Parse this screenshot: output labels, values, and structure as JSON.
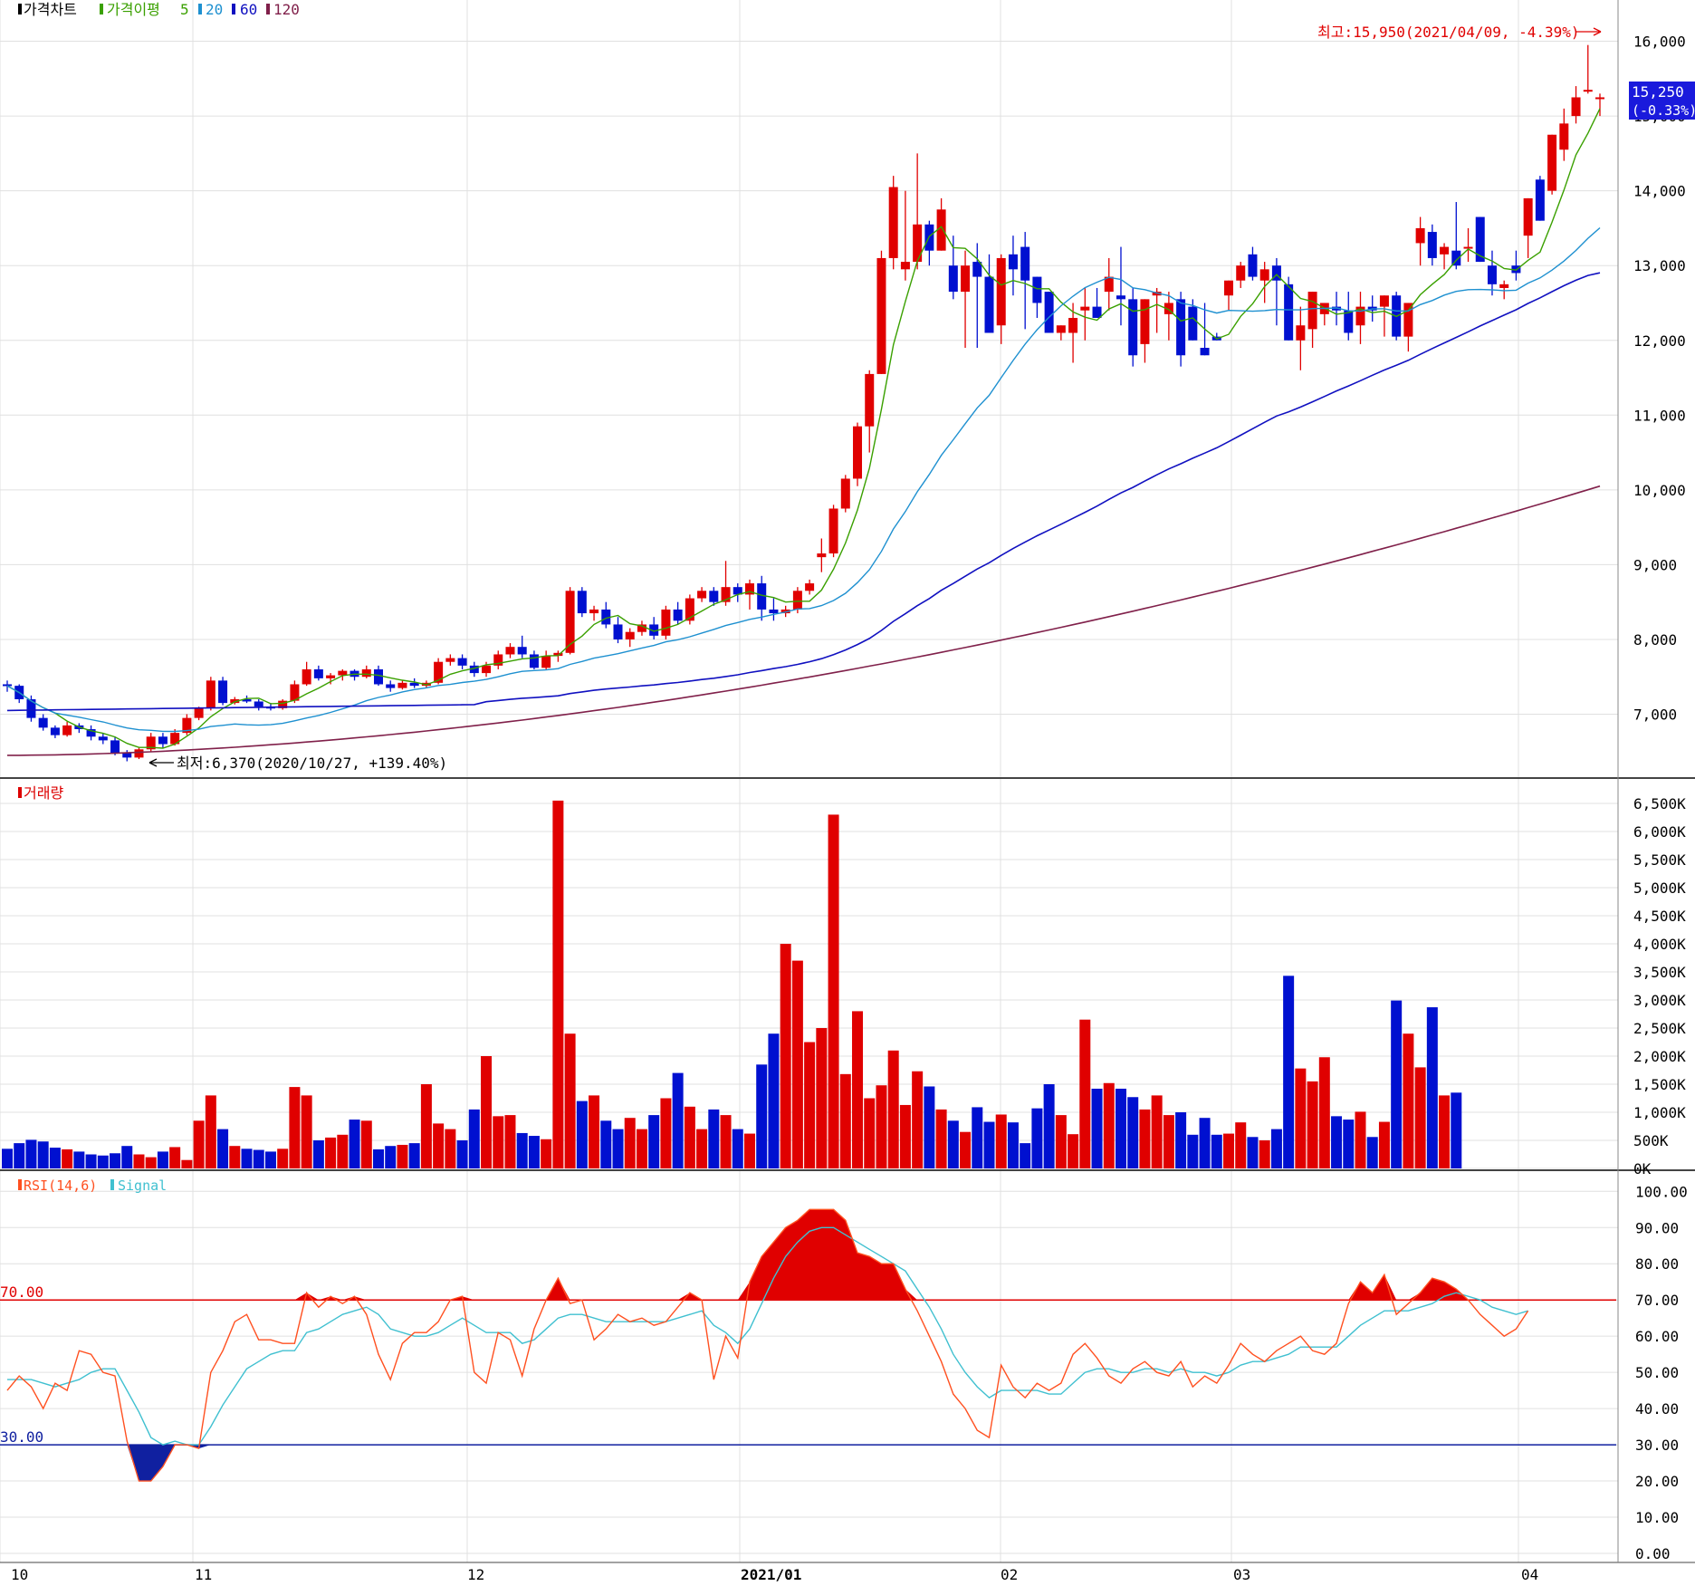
{
  "legend": {
    "price": {
      "label": "가격차트",
      "color": "#000000"
    },
    "ma_label": "가격이평",
    "ma_periods": [
      {
        "label": "5",
        "color": "#3aa000"
      },
      {
        "label": "20",
        "color": "#1e90d0"
      },
      {
        "label": "60",
        "color": "#1010c0"
      },
      {
        "label": "120",
        "color": "#80204a"
      }
    ],
    "volume": {
      "label": "거래량",
      "color": "#dd0000"
    },
    "rsi": {
      "label": "RSI(14,6)",
      "color": "#ff5020"
    },
    "signal": {
      "label": "Signal",
      "color": "#40c0d0"
    }
  },
  "annotations": {
    "high": "최고:15,950(2021/04/09, -4.39%)",
    "low": "최저:6,370(2020/10/27, +139.40%)",
    "last_price": "15,250",
    "last_change": "(-0.33%)"
  },
  "colors": {
    "up": "#e00000",
    "down": "#0010d0",
    "grid": "#e0e0e0",
    "rsi_upper": "#e00000",
    "rsi_lower": "#1020a0"
  },
  "chart_data": [
    {
      "type": "candlestick",
      "series_names": [
        "가격차트",
        "가격이평 5",
        "20",
        "60",
        "120"
      ],
      "x_ticks": [
        "10",
        "11",
        "12",
        "2021/01",
        "02",
        "03",
        "04"
      ],
      "y_ticks": [
        "7,000",
        "8,000",
        "9,000",
        "10,000",
        "11,000",
        "12,000",
        "13,000",
        "14,000",
        "15,000",
        "16,000"
      ],
      "ylim": [
        6200,
        16500
      ],
      "grid": true,
      "ohlc": [
        [
          7400,
          7450,
          7300,
          7380
        ],
        [
          7380,
          7400,
          7150,
          7200
        ],
        [
          7200,
          7250,
          6900,
          6950
        ],
        [
          6950,
          7000,
          6780,
          6820
        ],
        [
          6820,
          6850,
          6680,
          6720
        ],
        [
          6720,
          6900,
          6700,
          6850
        ],
        [
          6850,
          6880,
          6750,
          6800
        ],
        [
          6800,
          6850,
          6650,
          6700
        ],
        [
          6700,
          6750,
          6600,
          6650
        ],
        [
          6650,
          6700,
          6450,
          6480
        ],
        [
          6480,
          6520,
          6370,
          6420
        ],
        [
          6420,
          6550,
          6400,
          6530
        ],
        [
          6530,
          6750,
          6500,
          6700
        ],
        [
          6700,
          6750,
          6550,
          6600
        ],
        [
          6600,
          6800,
          6580,
          6750
        ],
        [
          6750,
          7000,
          6720,
          6950
        ],
        [
          6950,
          7100,
          6920,
          7080
        ],
        [
          7080,
          7500,
          7050,
          7450
        ],
        [
          7450,
          7500,
          7120,
          7150
        ],
        [
          7150,
          7230,
          7130,
          7200
        ],
        [
          7200,
          7250,
          7150,
          7170
        ],
        [
          7170,
          7200,
          7050,
          7100
        ],
        [
          7100,
          7150,
          7050,
          7080
        ],
        [
          7080,
          7200,
          7060,
          7180
        ],
        [
          7180,
          7450,
          7150,
          7400
        ],
        [
          7400,
          7700,
          7380,
          7600
        ],
        [
          7600,
          7650,
          7450,
          7480
        ],
        [
          7480,
          7550,
          7400,
          7520
        ],
        [
          7520,
          7600,
          7450,
          7580
        ],
        [
          7580,
          7600,
          7450,
          7500
        ],
        [
          7500,
          7650,
          7480,
          7600
        ],
        [
          7600,
          7650,
          7380,
          7400
        ],
        [
          7400,
          7450,
          7300,
          7350
        ],
        [
          7350,
          7450,
          7330,
          7420
        ],
        [
          7420,
          7480,
          7350,
          7380
        ],
        [
          7380,
          7450,
          7350,
          7420
        ],
        [
          7420,
          7750,
          7400,
          7700
        ],
        [
          7700,
          7800,
          7650,
          7750
        ],
        [
          7750,
          7800,
          7600,
          7650
        ],
        [
          7650,
          7700,
          7500,
          7550
        ],
        [
          7550,
          7700,
          7500,
          7650
        ],
        [
          7650,
          7850,
          7600,
          7800
        ],
        [
          7800,
          7950,
          7750,
          7900
        ],
        [
          7900,
          8050,
          7750,
          7800
        ],
        [
          7800,
          7850,
          7600,
          7620
        ],
        [
          7620,
          7850,
          7600,
          7780
        ],
        [
          7780,
          7850,
          7700,
          7820
        ],
        [
          7820,
          8700,
          7800,
          8650
        ],
        [
          8650,
          8700,
          8300,
          8350
        ],
        [
          8350,
          8450,
          8250,
          8400
        ],
        [
          8400,
          8500,
          8150,
          8200
        ],
        [
          8200,
          8300,
          7950,
          8000
        ],
        [
          8000,
          8150,
          7900,
          8100
        ],
        [
          8100,
          8250,
          8050,
          8200
        ],
        [
          8200,
          8300,
          8000,
          8050
        ],
        [
          8050,
          8450,
          8000,
          8400
        ],
        [
          8400,
          8500,
          8200,
          8250
        ],
        [
          8250,
          8600,
          8200,
          8550
        ],
        [
          8550,
          8700,
          8500,
          8650
        ],
        [
          8650,
          8700,
          8450,
          8500
        ],
        [
          8500,
          9050,
          8450,
          8700
        ],
        [
          8700,
          8750,
          8500,
          8600
        ],
        [
          8600,
          8800,
          8400,
          8750
        ],
        [
          8750,
          8850,
          8250,
          8400
        ],
        [
          8400,
          8550,
          8250,
          8350
        ],
        [
          8350,
          8450,
          8300,
          8400
        ],
        [
          8400,
          8700,
          8350,
          8650
        ],
        [
          8650,
          8800,
          8600,
          8750
        ],
        [
          9100,
          9350,
          8900,
          9150
        ],
        [
          9150,
          9800,
          9100,
          9750
        ],
        [
          9750,
          10200,
          9700,
          10150
        ],
        [
          10150,
          10900,
          10050,
          10850
        ],
        [
          10850,
          11600,
          10500,
          11550
        ],
        [
          11550,
          13200,
          11550,
          13100
        ],
        [
          13100,
          14200,
          12950,
          14050
        ],
        [
          12950,
          14000,
          12800,
          13050
        ],
        [
          13050,
          14500,
          12950,
          13550
        ],
        [
          13550,
          13600,
          13000,
          13200
        ],
        [
          13200,
          13900,
          13400,
          13750
        ],
        [
          13000,
          13400,
          12550,
          12650
        ],
        [
          12650,
          13200,
          11900,
          13000
        ],
        [
          13050,
          13300,
          11900,
          12850
        ],
        [
          12850,
          13150,
          12100,
          12100
        ],
        [
          12200,
          13150,
          11950,
          13100
        ],
        [
          13150,
          13400,
          12600,
          12950
        ],
        [
          13250,
          13450,
          12150,
          12800
        ],
        [
          12850,
          12700,
          12300,
          12500
        ],
        [
          12650,
          12550,
          12150,
          12100
        ],
        [
          12100,
          12200,
          12000,
          12200
        ],
        [
          12100,
          12500,
          11700,
          12300
        ],
        [
          12400,
          12700,
          12000,
          12450
        ],
        [
          12450,
          12700,
          12300,
          12300
        ],
        [
          12650,
          13100,
          12400,
          12850
        ],
        [
          12600,
          13250,
          12200,
          12550
        ],
        [
          12550,
          12700,
          11650,
          11800
        ],
        [
          11950,
          12350,
          11700,
          12550
        ],
        [
          12600,
          12700,
          12100,
          12650
        ],
        [
          12350,
          12650,
          12000,
          12500
        ],
        [
          12550,
          12650,
          11650,
          11800
        ],
        [
          12450,
          12550,
          12050,
          12000
        ],
        [
          11900,
          12500,
          12150,
          11800
        ],
        [
          12050,
          12100,
          12050,
          12000
        ],
        [
          12600,
          12700,
          12400,
          12800
        ],
        [
          12800,
          13050,
          12700,
          13000
        ],
        [
          13150,
          13250,
          12800,
          12850
        ],
        [
          12800,
          13050,
          12500,
          12950
        ],
        [
          13000,
          13100,
          12200,
          12800
        ],
        [
          12750,
          12850,
          12050,
          12000
        ],
        [
          12000,
          12450,
          11600,
          12200
        ],
        [
          12150,
          12300,
          11900,
          12650
        ],
        [
          12350,
          12450,
          12200,
          12500
        ],
        [
          12450,
          12650,
          12200,
          12400
        ],
        [
          12400,
          12650,
          12000,
          12100
        ],
        [
          12200,
          12650,
          11950,
          12450
        ],
        [
          12450,
          12600,
          12250,
          12400
        ],
        [
          12450,
          12250,
          12050,
          12600
        ],
        [
          12600,
          12650,
          12000,
          12050
        ],
        [
          12050,
          12050,
          11850,
          12500
        ],
        [
          13300,
          13650,
          13000,
          13500
        ],
        [
          13450,
          13550,
          13000,
          13100
        ],
        [
          13150,
          13300,
          12950,
          13250
        ],
        [
          13200,
          13850,
          12950,
          13000
        ],
        [
          13250,
          13500,
          13050,
          13250
        ],
        [
          13650,
          13600,
          13300,
          13050
        ],
        [
          13000,
          13200,
          12600,
          12750
        ],
        [
          12700,
          12800,
          12550,
          12750
        ],
        [
          13000,
          13200,
          12800,
          12900
        ],
        [
          13400,
          13900,
          13100,
          13900
        ],
        [
          14150,
          14200,
          14150,
          13600
        ],
        [
          14000,
          14400,
          13950,
          14750
        ],
        [
          14550,
          15100,
          14400,
          14900
        ],
        [
          15000,
          15400,
          14900,
          15250
        ],
        [
          15350,
          15950,
          15300,
          15350
        ],
        [
          15250,
          15300,
          15000,
          15250
        ]
      ],
      "ma5_endpoints": [
        7430,
        14800,
        15950
      ]
    },
    {
      "type": "bar",
      "series_names": [
        "거래량"
      ],
      "y_ticks": [
        "0K",
        "500K",
        "1,000K",
        "1,500K",
        "2,000K",
        "2,500K",
        "3,000K",
        "3,500K",
        "4,000K",
        "4,500K",
        "5,000K",
        "5,500K",
        "6,000K",
        "6,500K"
      ],
      "ylim": [
        0,
        6800000
      ],
      "values": [
        350000,
        450000,
        510000,
        480000,
        370000,
        340000,
        300000,
        250000,
        230000,
        270000,
        400000,
        250000,
        200000,
        300000,
        380000,
        150000,
        850000,
        1300000,
        700000,
        400000,
        350000,
        330000,
        300000,
        350000,
        1450000,
        1300000,
        500000,
        550000,
        600000,
        870000,
        850000,
        340000,
        400000,
        420000,
        450000,
        1500000,
        800000,
        700000,
        500000,
        1050000,
        2000000,
        930000,
        950000,
        630000,
        580000,
        520000,
        6550000,
        2400000,
        1200000,
        1300000,
        850000,
        700000,
        900000,
        700000,
        950000,
        1250000,
        1700000,
        1100000,
        700000,
        1050000,
        950000,
        700000,
        620000,
        1850000,
        2400000,
        4000000,
        3700000,
        2250000,
        2500000,
        6300000,
        1680000,
        2800000,
        1250000,
        1480000,
        2100000,
        1130000,
        1730000,
        1460000,
        1050000,
        850000,
        650000,
        1090000,
        830000,
        960000,
        820000,
        450000,
        1070000,
        1500000,
        950000,
        610000,
        2650000,
        1420000,
        1520000,
        1420000,
        1270000,
        1050000,
        1300000,
        950000,
        1000000,
        600000,
        900000,
        600000,
        620000,
        820000,
        560000,
        500000,
        700000,
        3430000,
        1780000,
        1550000,
        1980000,
        930000,
        870000,
        1010000,
        560000,
        830000,
        2990000,
        2400000,
        1800000,
        2870000,
        1300000,
        1350000
      ]
    },
    {
      "type": "line",
      "series_names": [
        "RSI(14,6)",
        "Signal"
      ],
      "y_ticks": [
        "0.00",
        "10.00",
        "20.00",
        "30.00",
        "40.00",
        "50.00",
        "60.00",
        "70.00",
        "80.00",
        "90.00",
        "100.00"
      ],
      "ylim": [
        0,
        100
      ],
      "reference_lines": [
        {
          "value": 70,
          "label": "70.00"
        },
        {
          "value": 30,
          "label": "30.00"
        }
      ],
      "rsi": [
        45,
        49,
        46,
        40,
        47,
        45,
        56,
        55,
        50,
        49,
        31,
        20,
        20,
        24,
        30,
        30,
        29,
        50,
        56,
        64,
        66,
        59,
        59,
        58,
        58,
        72,
        68,
        71,
        69,
        71,
        66,
        55,
        48,
        58,
        61,
        61,
        64,
        70,
        71,
        50,
        47,
        61,
        59,
        49,
        62,
        70,
        76,
        69,
        70,
        59,
        62,
        66,
        64,
        65,
        63,
        64,
        68,
        72,
        70,
        48,
        60,
        54,
        75,
        82,
        86,
        90,
        92,
        95,
        95,
        95,
        92,
        83,
        82,
        80,
        80,
        73,
        67,
        60,
        53,
        44,
        40,
        34,
        32,
        52,
        46,
        43,
        47,
        45,
        47,
        55,
        58,
        54,
        49,
        47,
        51,
        53,
        50,
        49,
        53,
        46,
        49,
        47,
        52,
        58,
        55,
        53,
        56,
        58,
        60,
        56,
        55,
        58,
        69,
        75,
        72,
        77,
        66,
        69,
        72,
        76,
        75,
        73,
        70,
        66,
        63,
        60,
        62,
        67
      ],
      "signal": [
        48,
        48,
        48,
        47,
        46,
        47,
        48,
        50,
        51,
        51,
        45,
        39,
        32,
        30,
        31,
        30,
        30,
        35,
        41,
        46,
        51,
        53,
        55,
        56,
        56,
        61,
        62,
        64,
        66,
        67,
        68,
        66,
        62,
        61,
        60,
        60,
        61,
        63,
        65,
        63,
        61,
        61,
        61,
        58,
        59,
        62,
        65,
        66,
        66,
        65,
        64,
        64,
        64,
        64,
        64,
        64,
        65,
        66,
        67,
        63,
        61,
        58,
        62,
        69,
        76,
        82,
        86,
        89,
        90,
        90,
        88,
        86,
        84,
        82,
        80,
        78,
        73,
        68,
        62,
        55,
        50,
        46,
        43,
        45,
        45,
        45,
        45,
        44,
        44,
        47,
        50,
        51,
        51,
        50,
        50,
        51,
        51,
        50,
        51,
        50,
        50,
        49,
        50,
        52,
        53,
        53,
        54,
        55,
        57,
        57,
        57,
        57,
        60,
        63,
        65,
        67,
        67,
        67,
        68,
        69,
        71,
        72,
        71,
        70,
        68,
        67,
        66,
        67
      ]
    }
  ]
}
